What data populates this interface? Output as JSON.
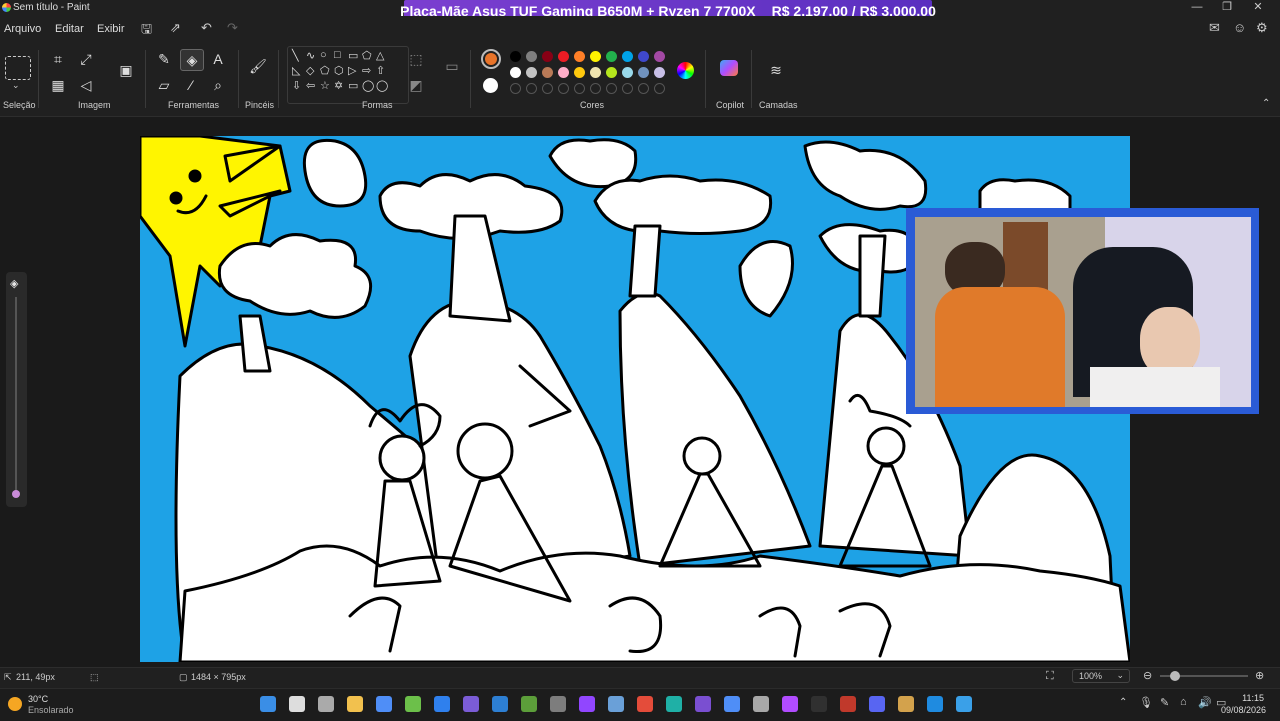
{
  "window": {
    "title": "Sem título - Paint",
    "promo_left": "Placa-Mãe Asus TUF Gaming B650M + Ryzen 7 7700X",
    "promo_right": "R$ 2.197,00 / R$ 3.000,00",
    "minimize": "—",
    "restore": "❐",
    "close": "✕"
  },
  "menu": {
    "file": "Arquivo",
    "edit": "Editar",
    "view": "Exibir"
  },
  "ribbon": {
    "groups": {
      "selection": "Seleção",
      "image": "Imagem",
      "tools": "Ferramentas",
      "brushes": "Pincéis",
      "shapes": "Formas",
      "colors": "Cores",
      "copilot": "Copilot",
      "layers": "Camadas"
    },
    "shapes_glyphs": [
      "╲",
      "∿",
      "○",
      "□",
      "▭",
      "⬠",
      "△",
      "◺",
      "◇",
      "⬠",
      "⬡",
      "▷",
      "⇨",
      "⇧",
      "⇩",
      "⇦",
      "☆",
      "✡",
      "▭",
      "◯",
      "◯"
    ],
    "palette": {
      "primary": "#e8742a",
      "secondary": "#ffffff",
      "row1": [
        "#000000",
        "#7f7f7f",
        "#880015",
        "#ed1c24",
        "#ff7f27",
        "#fff200",
        "#22b14c",
        "#00a2e8",
        "#3f48cc",
        "#a349a4"
      ],
      "row2": [
        "#ffffff",
        "#c3c3c3",
        "#b97a57",
        "#ffaec9",
        "#ffc90e",
        "#efe4b0",
        "#b5e61d",
        "#99d9ea",
        "#7092be",
        "#c8bfe7"
      ]
    }
  },
  "status": {
    "cursor": "211, 49px",
    "size": "1484 × 795px",
    "zoom": "100%"
  },
  "taskbar": {
    "weather_temp": "30°C",
    "weather_desc": "Ensolarado",
    "time": "11:15",
    "date": "09/08/2026"
  }
}
